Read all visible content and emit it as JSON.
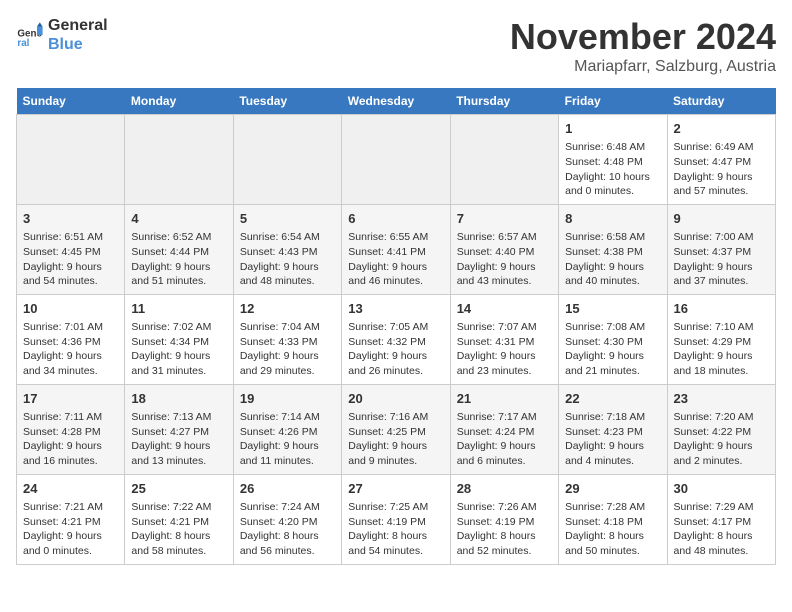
{
  "logo": {
    "line1": "General",
    "line2": "Blue"
  },
  "title": "November 2024",
  "subtitle": "Mariapfarr, Salzburg, Austria",
  "days_header": [
    "Sunday",
    "Monday",
    "Tuesday",
    "Wednesday",
    "Thursday",
    "Friday",
    "Saturday"
  ],
  "weeks": [
    [
      {
        "day": "",
        "info": ""
      },
      {
        "day": "",
        "info": ""
      },
      {
        "day": "",
        "info": ""
      },
      {
        "day": "",
        "info": ""
      },
      {
        "day": "",
        "info": ""
      },
      {
        "day": "1",
        "info": "Sunrise: 6:48 AM\nSunset: 4:48 PM\nDaylight: 10 hours and 0 minutes."
      },
      {
        "day": "2",
        "info": "Sunrise: 6:49 AM\nSunset: 4:47 PM\nDaylight: 9 hours and 57 minutes."
      }
    ],
    [
      {
        "day": "3",
        "info": "Sunrise: 6:51 AM\nSunset: 4:45 PM\nDaylight: 9 hours and 54 minutes."
      },
      {
        "day": "4",
        "info": "Sunrise: 6:52 AM\nSunset: 4:44 PM\nDaylight: 9 hours and 51 minutes."
      },
      {
        "day": "5",
        "info": "Sunrise: 6:54 AM\nSunset: 4:43 PM\nDaylight: 9 hours and 48 minutes."
      },
      {
        "day": "6",
        "info": "Sunrise: 6:55 AM\nSunset: 4:41 PM\nDaylight: 9 hours and 46 minutes."
      },
      {
        "day": "7",
        "info": "Sunrise: 6:57 AM\nSunset: 4:40 PM\nDaylight: 9 hours and 43 minutes."
      },
      {
        "day": "8",
        "info": "Sunrise: 6:58 AM\nSunset: 4:38 PM\nDaylight: 9 hours and 40 minutes."
      },
      {
        "day": "9",
        "info": "Sunrise: 7:00 AM\nSunset: 4:37 PM\nDaylight: 9 hours and 37 minutes."
      }
    ],
    [
      {
        "day": "10",
        "info": "Sunrise: 7:01 AM\nSunset: 4:36 PM\nDaylight: 9 hours and 34 minutes."
      },
      {
        "day": "11",
        "info": "Sunrise: 7:02 AM\nSunset: 4:34 PM\nDaylight: 9 hours and 31 minutes."
      },
      {
        "day": "12",
        "info": "Sunrise: 7:04 AM\nSunset: 4:33 PM\nDaylight: 9 hours and 29 minutes."
      },
      {
        "day": "13",
        "info": "Sunrise: 7:05 AM\nSunset: 4:32 PM\nDaylight: 9 hours and 26 minutes."
      },
      {
        "day": "14",
        "info": "Sunrise: 7:07 AM\nSunset: 4:31 PM\nDaylight: 9 hours and 23 minutes."
      },
      {
        "day": "15",
        "info": "Sunrise: 7:08 AM\nSunset: 4:30 PM\nDaylight: 9 hours and 21 minutes."
      },
      {
        "day": "16",
        "info": "Sunrise: 7:10 AM\nSunset: 4:29 PM\nDaylight: 9 hours and 18 minutes."
      }
    ],
    [
      {
        "day": "17",
        "info": "Sunrise: 7:11 AM\nSunset: 4:28 PM\nDaylight: 9 hours and 16 minutes."
      },
      {
        "day": "18",
        "info": "Sunrise: 7:13 AM\nSunset: 4:27 PM\nDaylight: 9 hours and 13 minutes."
      },
      {
        "day": "19",
        "info": "Sunrise: 7:14 AM\nSunset: 4:26 PM\nDaylight: 9 hours and 11 minutes."
      },
      {
        "day": "20",
        "info": "Sunrise: 7:16 AM\nSunset: 4:25 PM\nDaylight: 9 hours and 9 minutes."
      },
      {
        "day": "21",
        "info": "Sunrise: 7:17 AM\nSunset: 4:24 PM\nDaylight: 9 hours and 6 minutes."
      },
      {
        "day": "22",
        "info": "Sunrise: 7:18 AM\nSunset: 4:23 PM\nDaylight: 9 hours and 4 minutes."
      },
      {
        "day": "23",
        "info": "Sunrise: 7:20 AM\nSunset: 4:22 PM\nDaylight: 9 hours and 2 minutes."
      }
    ],
    [
      {
        "day": "24",
        "info": "Sunrise: 7:21 AM\nSunset: 4:21 PM\nDaylight: 9 hours and 0 minutes."
      },
      {
        "day": "25",
        "info": "Sunrise: 7:22 AM\nSunset: 4:21 PM\nDaylight: 8 hours and 58 minutes."
      },
      {
        "day": "26",
        "info": "Sunrise: 7:24 AM\nSunset: 4:20 PM\nDaylight: 8 hours and 56 minutes."
      },
      {
        "day": "27",
        "info": "Sunrise: 7:25 AM\nSunset: 4:19 PM\nDaylight: 8 hours and 54 minutes."
      },
      {
        "day": "28",
        "info": "Sunrise: 7:26 AM\nSunset: 4:19 PM\nDaylight: 8 hours and 52 minutes."
      },
      {
        "day": "29",
        "info": "Sunrise: 7:28 AM\nSunset: 4:18 PM\nDaylight: 8 hours and 50 minutes."
      },
      {
        "day": "30",
        "info": "Sunrise: 7:29 AM\nSunset: 4:17 PM\nDaylight: 8 hours and 48 minutes."
      }
    ]
  ]
}
